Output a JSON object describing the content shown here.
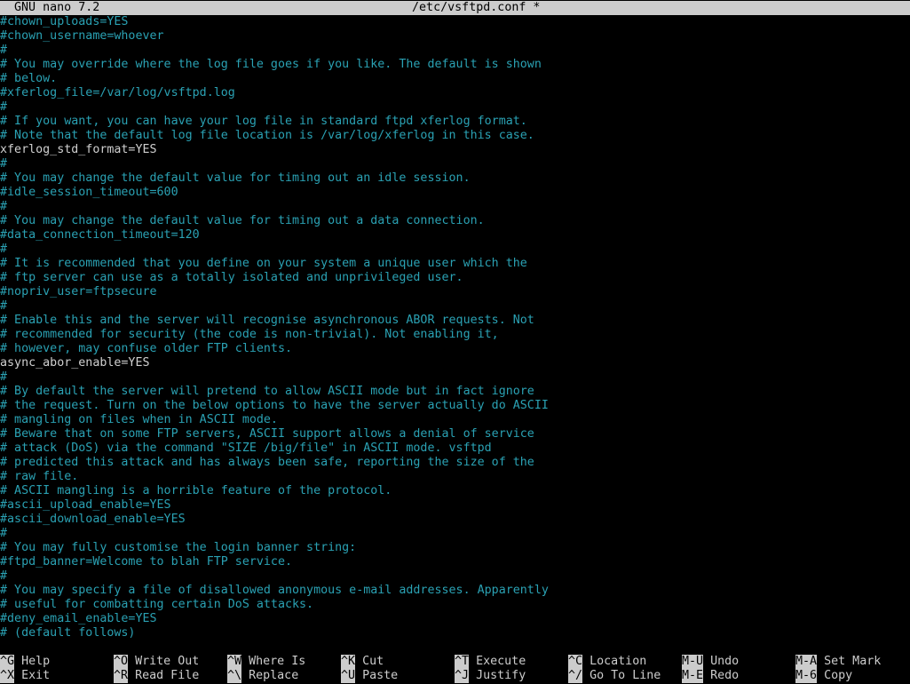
{
  "titlebar": {
    "app": "GNU nano 7.2",
    "file": "/etc/vsftpd.conf *"
  },
  "lines": [
    {
      "text": "#chown_uploads=YES",
      "type": "comment"
    },
    {
      "text": "#chown_username=whoever",
      "type": "comment"
    },
    {
      "text": "#",
      "type": "comment"
    },
    {
      "text": "# You may override where the log file goes if you like. The default is shown",
      "type": "comment"
    },
    {
      "text": "# below.",
      "type": "comment"
    },
    {
      "text": "#xferlog_file=/var/log/vsftpd.log",
      "type": "comment"
    },
    {
      "text": "#",
      "type": "comment"
    },
    {
      "text": "# If you want, you can have your log file in standard ftpd xferlog format.",
      "type": "comment"
    },
    {
      "text": "# Note that the default log file location is /var/log/xferlog in this case.",
      "type": "comment"
    },
    {
      "text": "xferlog_std_format=YES",
      "type": "plain"
    },
    {
      "text": "#",
      "type": "comment"
    },
    {
      "text": "# You may change the default value for timing out an idle session.",
      "type": "comment"
    },
    {
      "text": "#idle_session_timeout=600",
      "type": "comment"
    },
    {
      "text": "#",
      "type": "comment"
    },
    {
      "text": "# You may change the default value for timing out a data connection.",
      "type": "comment"
    },
    {
      "text": "#data_connection_timeout=120",
      "type": "comment"
    },
    {
      "text": "#",
      "type": "comment"
    },
    {
      "text": "# It is recommended that you define on your system a unique user which the",
      "type": "comment"
    },
    {
      "text": "# ftp server can use as a totally isolated and unprivileged user.",
      "type": "comment"
    },
    {
      "text": "#nopriv_user=ftpsecure",
      "type": "comment"
    },
    {
      "text": "#",
      "type": "comment"
    },
    {
      "text": "# Enable this and the server will recognise asynchronous ABOR requests. Not",
      "type": "comment"
    },
    {
      "text": "# recommended for security (the code is non-trivial). Not enabling it,",
      "type": "comment"
    },
    {
      "text": "# however, may confuse older FTP clients.",
      "type": "comment"
    },
    {
      "text": "async_abor_enable=YES",
      "type": "plain"
    },
    {
      "text": "#",
      "type": "comment"
    },
    {
      "text": "# By default the server will pretend to allow ASCII mode but in fact ignore",
      "type": "comment"
    },
    {
      "text": "# the request. Turn on the below options to have the server actually do ASCII",
      "type": "comment"
    },
    {
      "text": "# mangling on files when in ASCII mode.",
      "type": "comment"
    },
    {
      "text": "# Beware that on some FTP servers, ASCII support allows a denial of service",
      "type": "comment"
    },
    {
      "text": "# attack (DoS) via the command \"SIZE /big/file\" in ASCII mode. vsftpd",
      "type": "comment"
    },
    {
      "text": "# predicted this attack and has always been safe, reporting the size of the",
      "type": "comment"
    },
    {
      "text": "# raw file.",
      "type": "comment"
    },
    {
      "text": "# ASCII mangling is a horrible feature of the protocol.",
      "type": "comment"
    },
    {
      "text": "#ascii_upload_enable=YES",
      "type": "comment"
    },
    {
      "text": "#ascii_download_enable=YES",
      "type": "comment"
    },
    {
      "text": "#",
      "type": "comment"
    },
    {
      "text": "# You may fully customise the login banner string:",
      "type": "comment"
    },
    {
      "text": "#ftpd_banner=Welcome to blah FTP service.",
      "type": "comment"
    },
    {
      "text": "#",
      "type": "comment"
    },
    {
      "text": "# You may specify a file of disallowed anonymous e-mail addresses. Apparently",
      "type": "comment"
    },
    {
      "text": "# useful for combatting certain DoS attacks.",
      "type": "comment"
    },
    {
      "text": "#deny_email_enable=YES",
      "type": "comment"
    },
    {
      "text": "# (default follows)",
      "type": "comment"
    }
  ],
  "shortcuts": [
    {
      "key": "^G",
      "label": "Help"
    },
    {
      "key": "^X",
      "label": "Exit"
    },
    {
      "key": "^O",
      "label": "Write Out"
    },
    {
      "key": "^R",
      "label": "Read File"
    },
    {
      "key": "^W",
      "label": "Where Is"
    },
    {
      "key": "^\\",
      "label": "Replace"
    },
    {
      "key": "^K",
      "label": "Cut"
    },
    {
      "key": "^U",
      "label": "Paste"
    },
    {
      "key": "^T",
      "label": "Execute"
    },
    {
      "key": "^J",
      "label": "Justify"
    },
    {
      "key": "^C",
      "label": "Location"
    },
    {
      "key": "^/",
      "label": "Go To Line"
    },
    {
      "key": "M-U",
      "label": "Undo"
    },
    {
      "key": "M-E",
      "label": "Redo"
    },
    {
      "key": "M-A",
      "label": "Set Mark"
    },
    {
      "key": "M-6",
      "label": "Copy"
    }
  ],
  "colors": {
    "comment": "#2aa1b3",
    "plain": "#d0d0d0",
    "bar": "#cccccc",
    "background": "#000000"
  }
}
